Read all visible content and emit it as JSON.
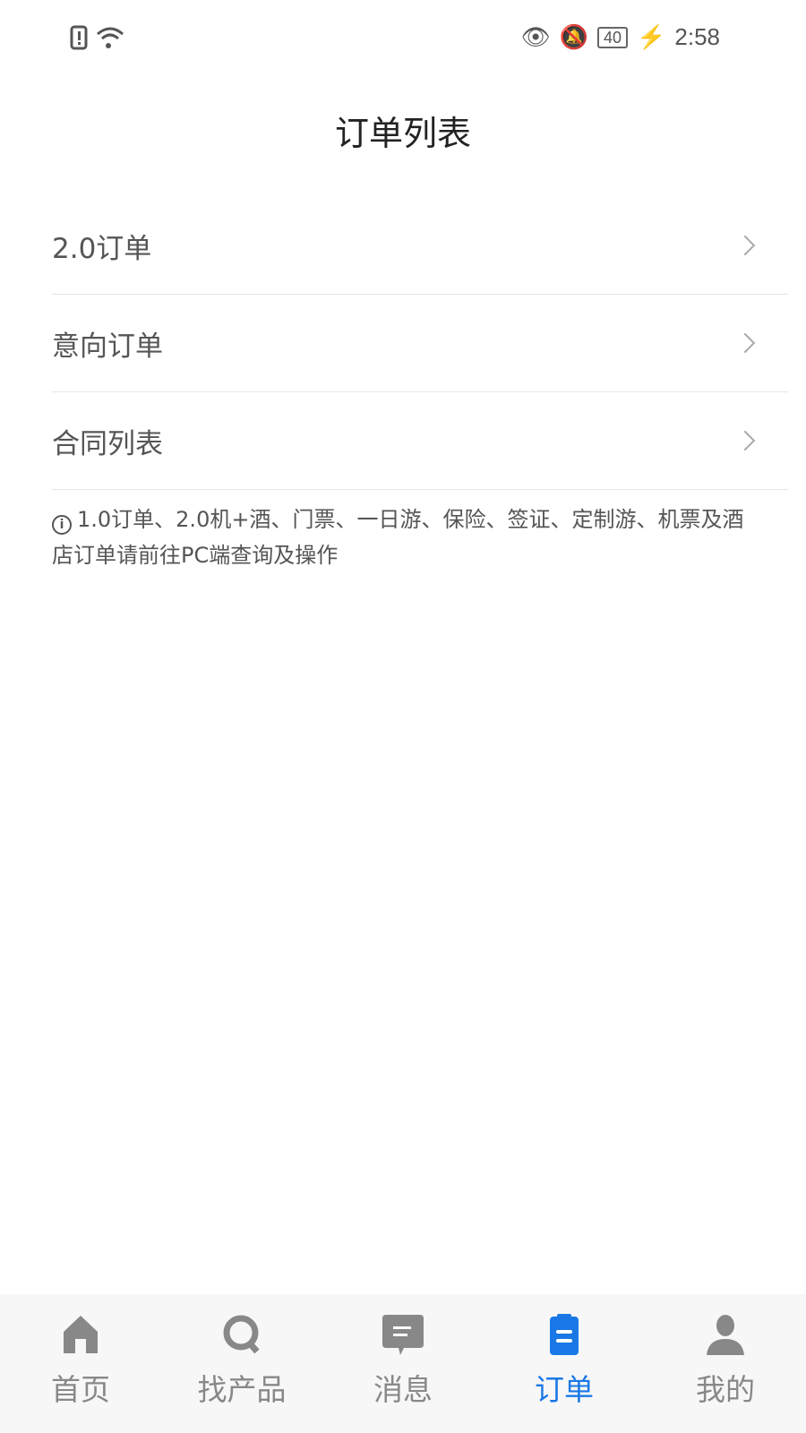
{
  "status_bar": {
    "battery": "40",
    "time": "2:58"
  },
  "header": {
    "title": "订单列表"
  },
  "list": [
    {
      "label": "2.0订单"
    },
    {
      "label": "意向订单"
    },
    {
      "label": "合同列表"
    }
  ],
  "note": "1.0订单、2.0机+酒、门票、一日游、保险、签证、定制游、机票及酒店订单请前往PC端查询及操作",
  "tabs": [
    {
      "label": "首页",
      "icon": "home-icon"
    },
    {
      "label": "找产品",
      "icon": "search-icon"
    },
    {
      "label": "消息",
      "icon": "message-icon"
    },
    {
      "label": "订单",
      "icon": "order-icon",
      "active": true
    },
    {
      "label": "我的",
      "icon": "user-icon"
    }
  ],
  "colors": {
    "accent": "#1a78e6",
    "inactive": "#888888"
  }
}
